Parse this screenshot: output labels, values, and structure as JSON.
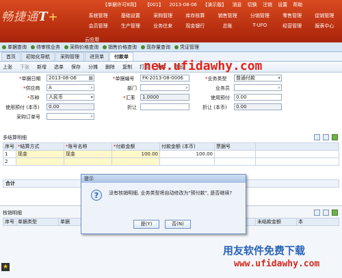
{
  "header": {
    "logo_main": "畅捷通",
    "logo_t": "T",
    "logo_plus": "+",
    "info": [
      "【单据许可8用】",
      "【001】",
      "2013-08-06",
      "【演示版】",
      "消息"
    ],
    "actions": [
      "切换",
      "注销",
      "设置",
      "帮助"
    ],
    "menu": [
      "系统管理",
      "基础设置",
      "采购管理",
      "库存核算",
      "销售管理",
      "分销管理",
      "零售管理",
      "促销管理",
      "会员管理",
      "生产管理",
      "业务往来",
      "现金银行",
      "总账",
      "T-UFO",
      "经营管理",
      "报表中心"
    ],
    "cloud": "云应用"
  },
  "quick_tabs": [
    "单据查询",
    "待审核业务",
    "采购价格查询",
    "销售价格查询",
    "现存量查询",
    "凭证管理"
  ],
  "page_tabs": [
    {
      "label": "首页",
      "active": false
    },
    {
      "label": "初始化导航",
      "active": false
    },
    {
      "label": "采购管理",
      "active": false
    },
    {
      "label": "进货单",
      "active": false
    },
    {
      "label": "付款单",
      "active": true
    }
  ],
  "toolbar": [
    "上张",
    "下张",
    "新增",
    "选单",
    "保存",
    "分摊",
    "删除",
    "复制",
    "打印",
    "附件",
    "退出"
  ],
  "watermark_url": "new.ufidawhy.com",
  "form": {
    "doc_date_label": "单据日期",
    "doc_date": "2013-08-06",
    "doc_no_label": "单据编号",
    "doc_no": "FK-2013-08-0006",
    "biz_type_label": "业务类型",
    "biz_type": "普通付款",
    "supplier_label": "供应商",
    "supplier": "A",
    "dept_label": "部门",
    "dept": "",
    "staff_label": "业务员",
    "staff": "",
    "currency_label": "币种",
    "currency": "人民币",
    "rate_label": "汇率",
    "rate": "1.0000",
    "use_prepay_label": "使用预付",
    "use_prepay": "0.00",
    "prepay_local_label": "使用预付 (本币)",
    "prepay_local": "0.00",
    "discount_label": "折让",
    "discount": "",
    "discount_local_label": "折让 (本币)",
    "discount_local": "0.00",
    "po_label": "采购订单号",
    "po": ""
  },
  "detail": {
    "tab": "多结算明细",
    "headers": [
      "序号",
      "结算方式",
      "账号名称",
      "付款金额",
      "付款金额 (本币)",
      "票据号"
    ],
    "rows": [
      [
        "1",
        "现金",
        "现金",
        "100.00",
        "100.00",
        ""
      ],
      [
        "2",
        "",
        "",
        "",
        "",
        ""
      ]
    ],
    "total_label": "合计"
  },
  "verify": {
    "title": "核销明细",
    "headers": [
      "序号",
      "单据类型",
      "单据",
      "",
      "",
      "",
      "",
      "结金额",
      "未结款金额",
      "本"
    ]
  },
  "dialog": {
    "title": "提示",
    "message": "没有核销明细, 业务类型将自动修改为\"预付款\", 是否继续?",
    "yes": "是(Y)",
    "no": "否(N)"
  },
  "watermark_cn": "用友软件免费下载",
  "watermark_site": "www.ufidawhy.com",
  "colors": {
    "header": "#c0361a",
    "accent_red": "#e0241b",
    "accent_blue": "#2a63b8"
  }
}
